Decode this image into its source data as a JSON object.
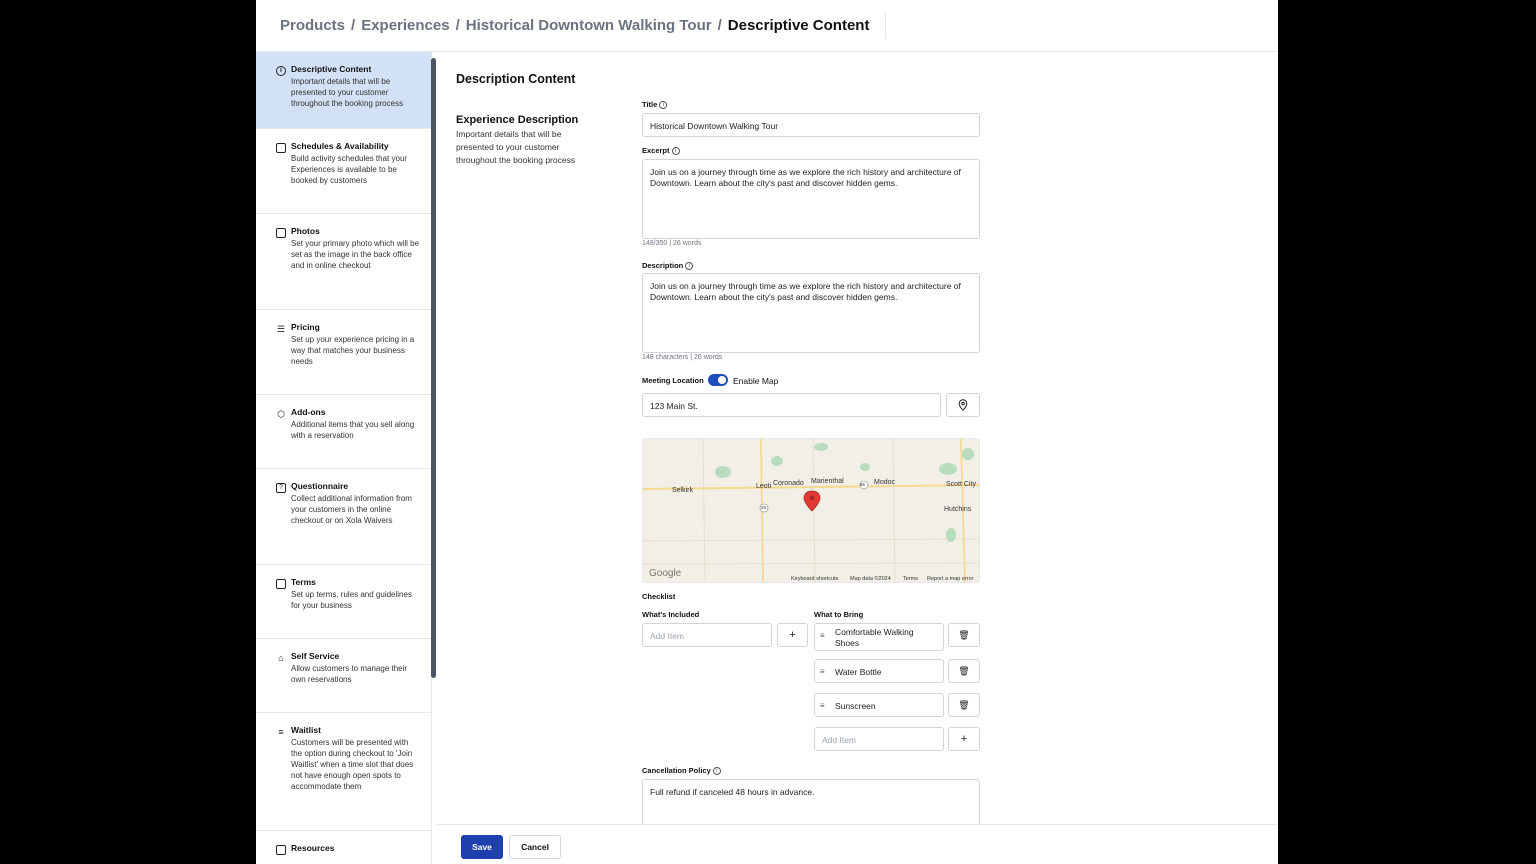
{
  "breadcrumb": {
    "items": [
      "Products",
      "Experiences",
      "Historical Downtown Walking Tour"
    ],
    "separator": "/",
    "current": "Descriptive Content"
  },
  "sidebar": {
    "items": [
      {
        "title": "Descriptive Content",
        "desc": "Important details that will be presented to your customer throughout the booking process",
        "icon": "info-icon",
        "active": true
      },
      {
        "title": "Schedules & Availability",
        "desc": "Build activity schedules that your Experiences is available to be booked by customers",
        "icon": "calendar-icon"
      },
      {
        "title": "Photos",
        "desc": "Set your primary photo which will be set as the image in the back office and in online checkout",
        "icon": "image-icon"
      },
      {
        "title": "Pricing",
        "desc": "Set up your experience pricing in a way that matches your business needs",
        "icon": "pricing-icon"
      },
      {
        "title": "Add-ons",
        "desc": "Additional items that you sell along with a reservation",
        "icon": "cube-icon"
      },
      {
        "title": "Questionnaire",
        "desc": "Collect additional information from your customers in the online checkout or on Xola Waivers",
        "icon": "question-icon"
      },
      {
        "title": "Terms",
        "desc": "Set up terms, rules and guidelines for your business",
        "icon": "document-icon"
      },
      {
        "title": "Self Service",
        "desc": "Allow customers to manage their own reservations",
        "icon": "self-service-icon"
      },
      {
        "title": "Waitlist",
        "desc": "Customers will be presented with the option during checkout to 'Join Waitlist' when a time slot that does not have enough open spots to accommodate them",
        "icon": "list-icon"
      },
      {
        "title": "Resources",
        "desc": "",
        "icon": "resource-icon"
      }
    ]
  },
  "main": {
    "section_title": "Description Content",
    "sub_title": "Experience Description",
    "sub_desc": "Important details that will be presented to your customer throughout the booking process",
    "title_label": "Title",
    "title_value": "Historical Downtown Walking Tour",
    "excerpt_label": "Excerpt",
    "excerpt_value": "Join us on a journey through time as we explore the rich history and architecture of Downtown. Learn about the city's past and discover hidden gems.",
    "excerpt_counter": "148/350 | 26 words",
    "description_label": "Description",
    "description_value": "Join us on a journey through time as we explore the rich history and architecture of Downtown. Learn about the city's past and discover hidden gems.",
    "description_counter": "148 characters | 26 words",
    "meeting_label": "Meeting Location",
    "enable_map_label": "Enable Map",
    "enable_map_on": true,
    "location_value": "123 Main St.",
    "map": {
      "places": [
        "Selkirk",
        "Leoti",
        "Coronado",
        "Marienthal",
        "Modoc",
        "Scott City",
        "Hutchins"
      ],
      "route_labels": [
        "96",
        "25"
      ],
      "logo": "Google",
      "attributions": [
        "Keyboard shortcuts",
        "Map data ©2024",
        "Terms",
        "Report a map error"
      ]
    },
    "checklist_label": "Checklist",
    "included_label": "What's Included",
    "included_placeholder": "Add Item",
    "bring_label": "What to Bring",
    "bring_items": [
      "Comfortable Walking Shoes",
      "Water Bottle",
      "Sunscreen"
    ],
    "bring_placeholder": "Add Item",
    "cancellation_label": "Cancellation Policy",
    "cancellation_value": "Full refund if canceled 48 hours in advance."
  },
  "footer": {
    "save_label": "Save",
    "cancel_label": "Cancel"
  },
  "colors": {
    "primary": "#1e40af",
    "active_nav": "#d2e1f6",
    "map_pin": "#e53935"
  }
}
